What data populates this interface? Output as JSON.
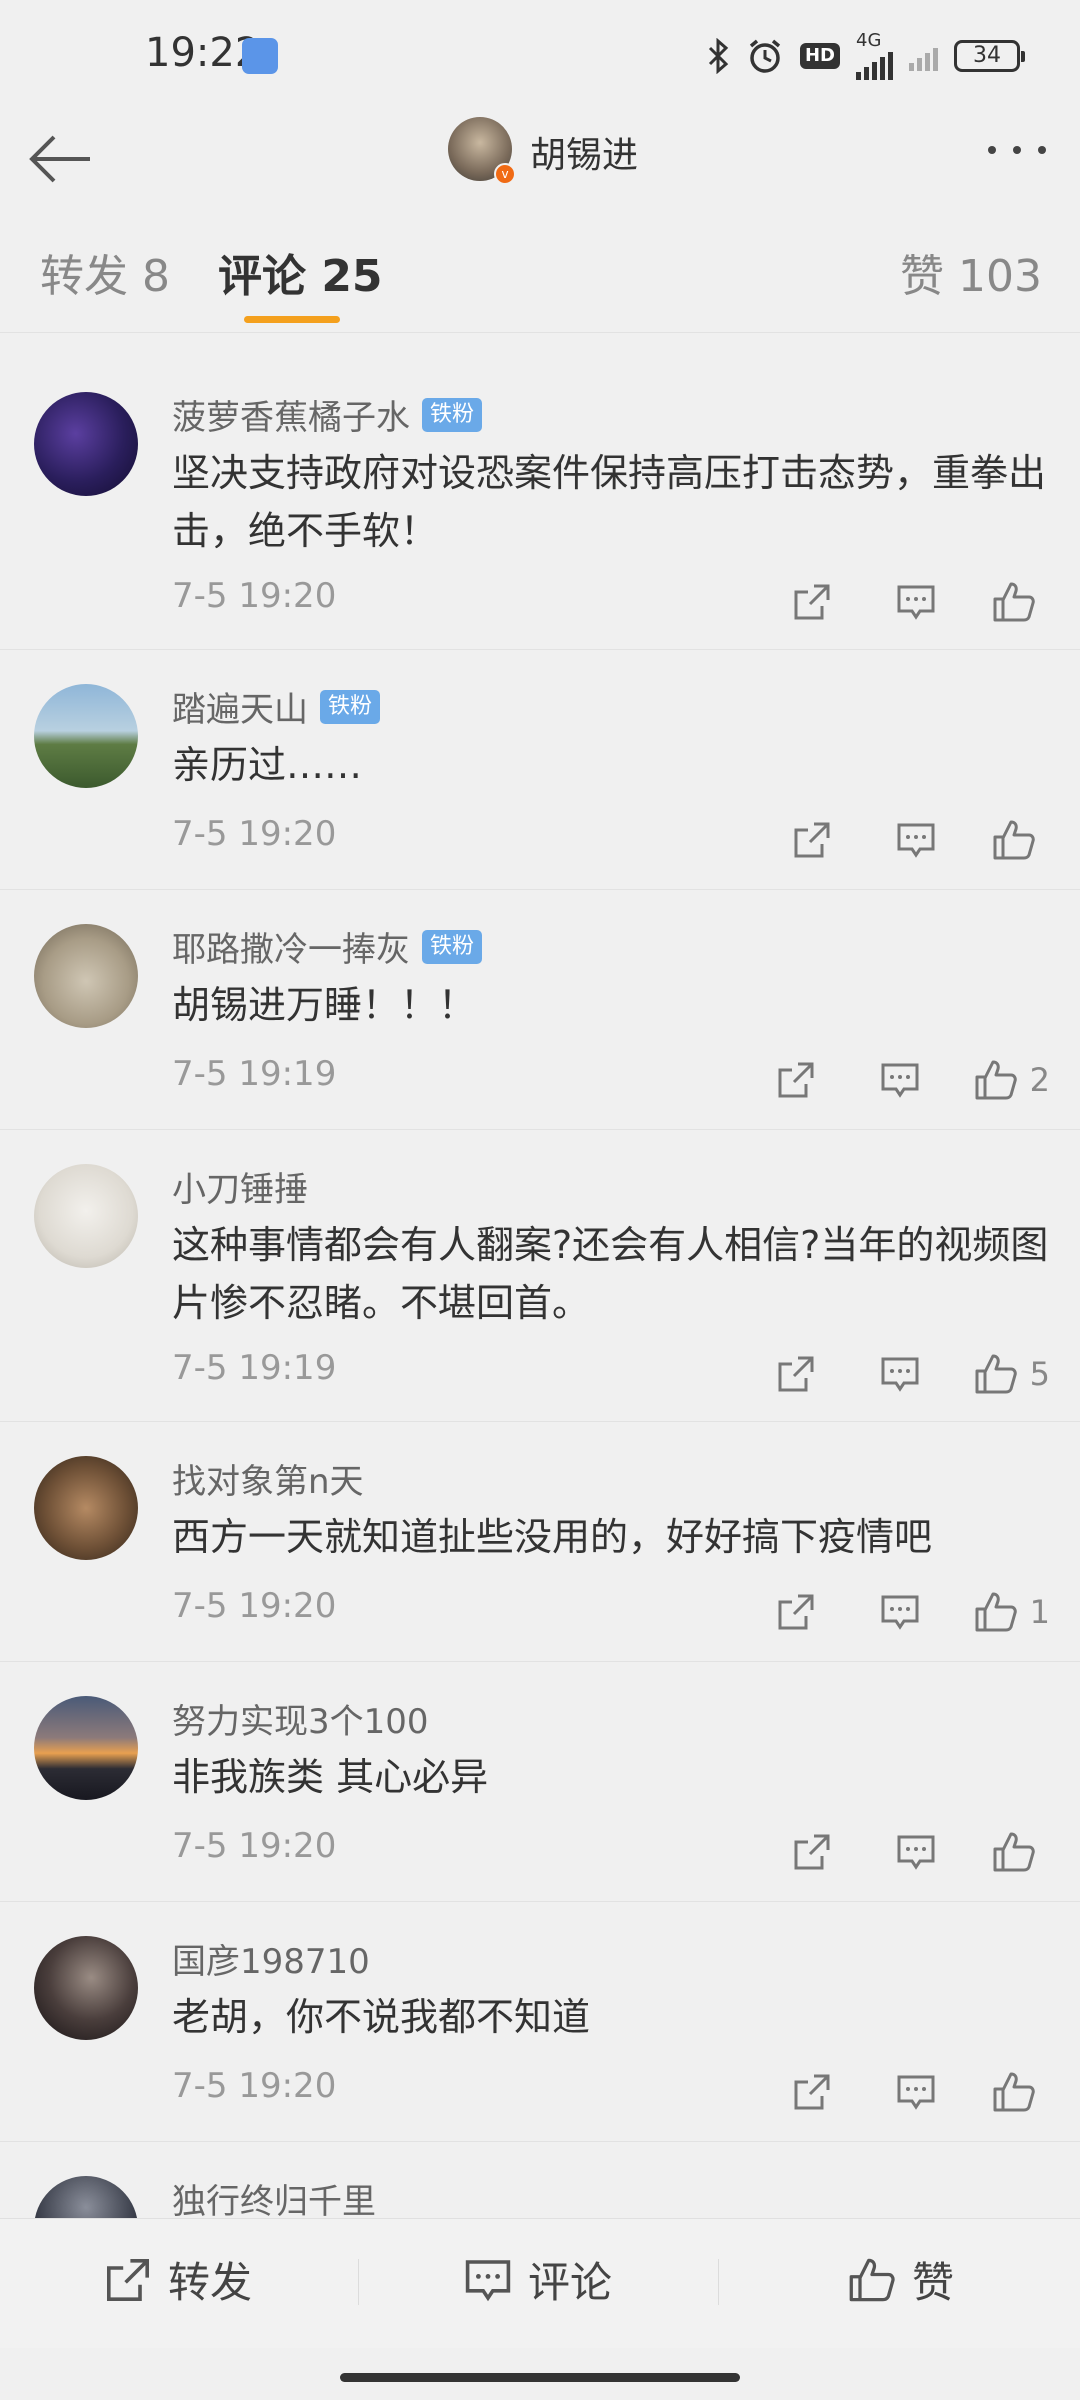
{
  "status_bar": {
    "time": "19:22",
    "network": "4G",
    "hd": "HD",
    "battery": "34"
  },
  "header": {
    "title": "胡锡进"
  },
  "tabs": {
    "repost": "转发 8",
    "comments": "评论 25",
    "likes": "赞 103"
  },
  "comments": [
    {
      "user": "菠萝香蕉橘子水",
      "badge": "铁粉",
      "text": "坚决支持政府对设恐案件保持高压打击态势，重拳出击，绝不手软！",
      "time": "7-5 19:20",
      "likes": ""
    },
    {
      "user": "踏遍天山",
      "badge": "铁粉",
      "text": "亲历过……",
      "time": "7-5 19:20",
      "likes": ""
    },
    {
      "user": "耶路撒冷一捧灰",
      "badge": "铁粉",
      "text": "胡锡进万睡！！！",
      "time": "7-5 19:19",
      "likes": "2"
    },
    {
      "user": "小刀锤捶",
      "badge": "",
      "text": "这种事情都会有人翻案?还会有人相信?当年的视频图片惨不忍睹。不堪回首。",
      "time": "7-5 19:19",
      "likes": "5"
    },
    {
      "user": "找对象第n天",
      "badge": "",
      "text": "西方一天就知道扯些没用的，好好搞下疫情吧",
      "time": "7-5 19:20",
      "likes": "1"
    },
    {
      "user": "努力实现3个100",
      "badge": "",
      "text": "非我族类 其心必异",
      "time": "7-5 19:20",
      "likes": ""
    },
    {
      "user": "国彦198710",
      "badge": "",
      "text": "老胡，你不说我都不知道",
      "time": "7-5 19:20",
      "likes": ""
    },
    {
      "user": "独行终归千里",
      "badge": "",
      "text": "",
      "time": "",
      "likes": ""
    }
  ],
  "bottom_bar": {
    "repost": "转发",
    "comment": "评论",
    "like": "赞"
  },
  "colors": {
    "background": "#f0f0f0",
    "tab_indicator": "#f4a01d",
    "fan_badge": "#6aa9e8",
    "verified": "#f06a14"
  }
}
